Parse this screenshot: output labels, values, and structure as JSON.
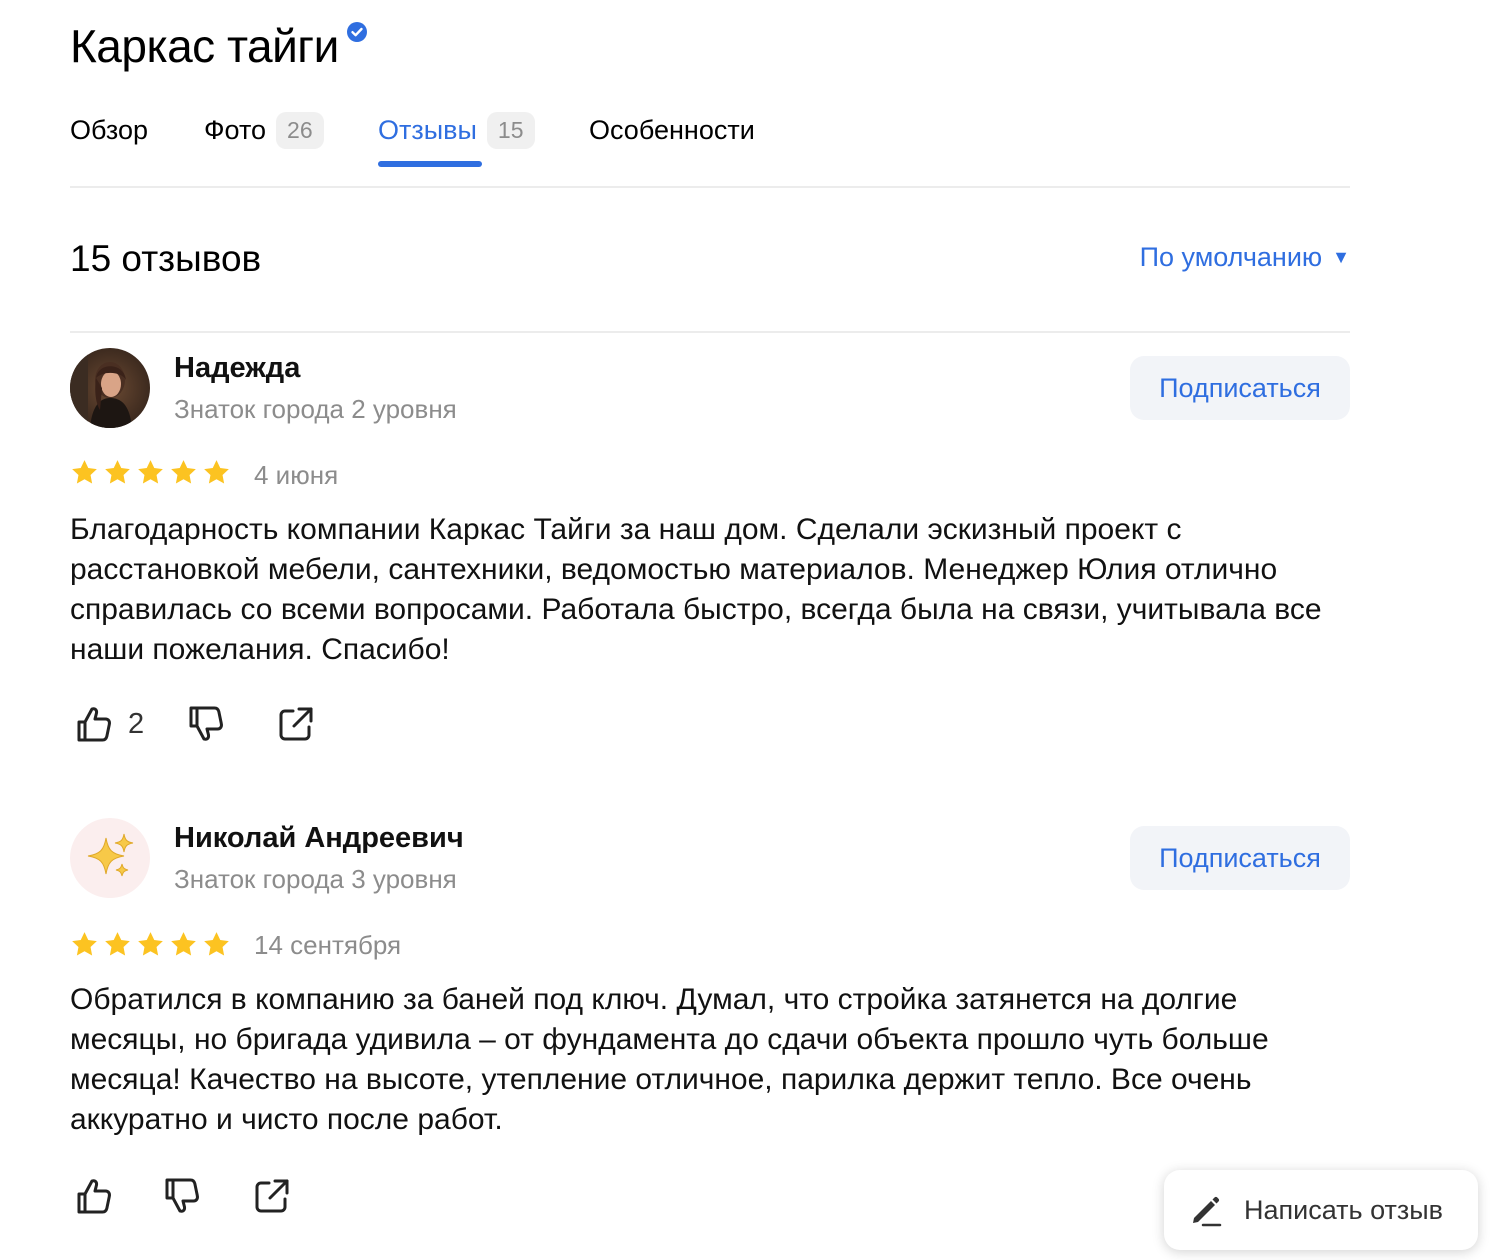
{
  "header": {
    "title": "Каркас тайги",
    "verified": true
  },
  "tabs": [
    {
      "label": "Обзор",
      "count": null,
      "active": false
    },
    {
      "label": "Фото",
      "count": "26",
      "active": false
    },
    {
      "label": "Отзывы",
      "count": "15",
      "active": true
    },
    {
      "label": "Особенности",
      "count": null,
      "active": false
    }
  ],
  "reviews_header": {
    "count_label": "15 отзывов",
    "sort_label": "По умолчанию"
  },
  "reviews": [
    {
      "author": "Надежда",
      "level": "Знаток города 2 уровня",
      "subscribe_label": "Подписаться",
      "rating": 5,
      "date": "4 июня",
      "text": "Благодарность компании Каркас Тайги за наш дом. Сделали эскизный проект с расстановкой мебели, сантехники, ведомостью материалов. Менеджер Юлия отлично справилась со всеми вопросами. Работала быстро, всегда была на связи, учитывала все наши пожелания. Спасибо!",
      "likes": "2"
    },
    {
      "author": "Николай Андреевич",
      "level": "Знаток города 3 уровня",
      "subscribe_label": "Подписаться",
      "rating": 5,
      "date": "14 сентября",
      "text": "Обратился в компанию за баней под ключ. Думал, что стройка затянется на долгие месяцы, но бригада удивила – от фундамента до сдачи объекта прошло чуть больше месяца! Качество на высоте, утепление отличное, парилка держит тепло. Все очень аккуратно и чисто после работ.",
      "likes": ""
    }
  ],
  "write_review_label": "Написать отзыв",
  "colors": {
    "accent": "#2f6ee0",
    "star": "#fcc321",
    "muted": "#8c8c8c"
  }
}
